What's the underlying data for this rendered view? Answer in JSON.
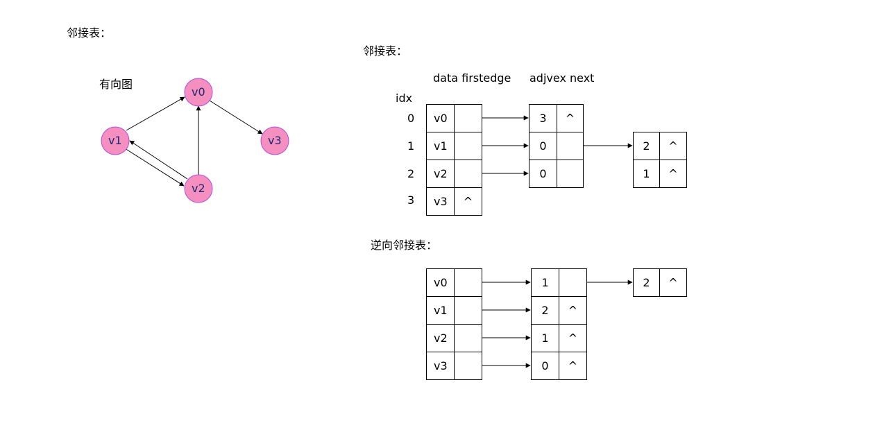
{
  "graph": {
    "section_title": "邻接表：",
    "subtitle": "有向图",
    "nodes": [
      "v0",
      "v1",
      "v2",
      "v3"
    ],
    "node_color": "#f48fc0",
    "node_border": "#b04de0"
  },
  "adjacency": {
    "title": "邻接表：",
    "header_vertex": "data firstedge",
    "header_edge": "adjvex next",
    "idx_label": "idx",
    "indices": [
      "0",
      "1",
      "2",
      "3"
    ],
    "vertices": [
      {
        "data": "v0",
        "firstedge": ""
      },
      {
        "data": "v1",
        "firstedge": ""
      },
      {
        "data": "v2",
        "firstedge": ""
      },
      {
        "data": "v3",
        "firstedge": "^"
      }
    ],
    "edges_col1": [
      {
        "adjvex": "3",
        "next": "^"
      },
      {
        "adjvex": "0",
        "next": ""
      },
      {
        "adjvex": "0",
        "next": ""
      }
    ],
    "edges_col2": [
      {
        "adjvex": "2",
        "next": "^"
      },
      {
        "adjvex": "1",
        "next": "^"
      }
    ]
  },
  "reverse": {
    "title": "逆向邻接表：",
    "vertices": [
      {
        "data": "v0",
        "firstedge": ""
      },
      {
        "data": "v1",
        "firstedge": ""
      },
      {
        "data": "v2",
        "firstedge": ""
      },
      {
        "data": "v3",
        "firstedge": ""
      }
    ],
    "edges_col1": [
      {
        "adjvex": "1",
        "next": ""
      },
      {
        "adjvex": "2",
        "next": "^"
      },
      {
        "adjvex": "1",
        "next": "^"
      },
      {
        "adjvex": "0",
        "next": "^"
      }
    ],
    "edges_col2": [
      {
        "adjvex": "2",
        "next": "^"
      }
    ]
  }
}
